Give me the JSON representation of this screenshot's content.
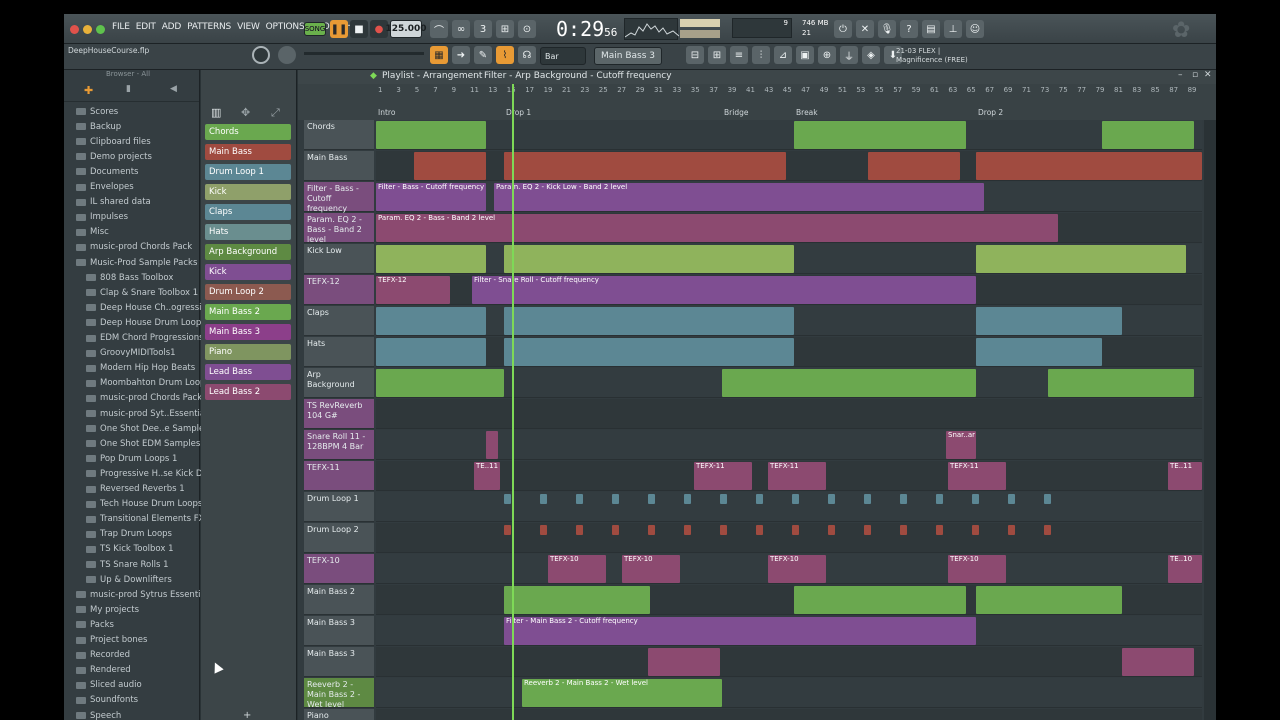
{
  "app": {
    "project_file": "DeepHouseCourse.flp",
    "menu": [
      "FILE",
      "EDIT",
      "ADD",
      "PATTERNS",
      "VIEW",
      "OPTIONS",
      "TOOLS",
      "HELP"
    ],
    "transport": {
      "mode": "SONG",
      "tempo": "125.000",
      "time": "0:29",
      "time_sub": "56",
      "cpu_mem": "746 MB",
      "cpu_voices": "21",
      "cpu_num": "9",
      "pattern": "Main Bass 3",
      "snap": "Bar",
      "hint_line1": "21-03 FLEX |",
      "hint_line2": "Magnificence (FREE)"
    }
  },
  "browser": {
    "title": "Browser - All",
    "items": [
      {
        "label": "Scores",
        "indent": false
      },
      {
        "label": "Backup",
        "indent": false
      },
      {
        "label": "Clipboard files",
        "indent": false
      },
      {
        "label": "Demo projects",
        "indent": false
      },
      {
        "label": "Documents",
        "indent": false
      },
      {
        "label": "Envelopes",
        "indent": false
      },
      {
        "label": "IL shared data",
        "indent": false
      },
      {
        "label": "Impulses",
        "indent": false
      },
      {
        "label": "Misc",
        "indent": false
      },
      {
        "label": "music-prod Chords Pack",
        "indent": false
      },
      {
        "label": "Music-Prod Sample Packs",
        "indent": false
      },
      {
        "label": "808 Bass Toolbox",
        "indent": true
      },
      {
        "label": "Clap & Snare Toolbox 1",
        "indent": true
      },
      {
        "label": "Deep House Ch..ogressions 1",
        "indent": true
      },
      {
        "label": "Deep House Drum Loops",
        "indent": true
      },
      {
        "label": "EDM Chord Progressions 1",
        "indent": true
      },
      {
        "label": "GroovyMIDITools1",
        "indent": true
      },
      {
        "label": "Modern Hip Hop Beats",
        "indent": true
      },
      {
        "label": "Moombahton Drum Loops",
        "indent": true
      },
      {
        "label": "music-prod Chords Pack",
        "indent": true
      },
      {
        "label": "music-prod Syt..Essentials 1",
        "indent": true
      },
      {
        "label": "One Shot Dee..e Samples #1",
        "indent": true
      },
      {
        "label": "One Shot EDM Samples #1",
        "indent": true
      },
      {
        "label": "Pop Drum Loops 1",
        "indent": true
      },
      {
        "label": "Progressive H..se Kick Drums",
        "indent": true
      },
      {
        "label": "Reversed Reverbs 1",
        "indent": true
      },
      {
        "label": "Tech House Drum Loops",
        "indent": true
      },
      {
        "label": "Transitional Elements FX",
        "indent": true
      },
      {
        "label": "Trap Drum Loops",
        "indent": true
      },
      {
        "label": "TS Kick Toolbox 1",
        "indent": true
      },
      {
        "label": "TS Snare Rolls 1",
        "indent": true
      },
      {
        "label": "Up & Downlifters",
        "indent": true
      },
      {
        "label": "music-prod Sytrus Essentials 1",
        "indent": false
      },
      {
        "label": "My projects",
        "indent": false
      },
      {
        "label": "Packs",
        "indent": false
      },
      {
        "label": "Project bones",
        "indent": false
      },
      {
        "label": "Recorded",
        "indent": false
      },
      {
        "label": "Rendered",
        "indent": false
      },
      {
        "label": "Sliced audio",
        "indent": false
      },
      {
        "label": "Soundfonts",
        "indent": false
      },
      {
        "label": "Speech",
        "indent": false
      }
    ]
  },
  "channels": [
    {
      "label": "Chords",
      "color": "#6aa84f"
    },
    {
      "label": "Main Bass",
      "color": "#a04b40"
    },
    {
      "label": "Drum Loop 1",
      "color": "#5c8794"
    },
    {
      "label": "Kick",
      "color": "#8fa06a"
    },
    {
      "label": "Claps",
      "color": "#5c8794"
    },
    {
      "label": "Hats",
      "color": "#6a8e8f"
    },
    {
      "label": "Arp Background",
      "color": "#5e8a43"
    },
    {
      "label": "Kick",
      "color": "#7f4e92"
    },
    {
      "label": "Drum Loop 2",
      "color": "#8c5a50"
    },
    {
      "label": "Main Bass 2",
      "color": "#6aa84f"
    },
    {
      "label": "Main Bass 3",
      "color": "#8c3f8a"
    },
    {
      "label": "Piano",
      "color": "#7f9560"
    },
    {
      "label": "Lead Bass",
      "color": "#7f4e92"
    },
    {
      "label": "Lead Bass 2",
      "color": "#8c4a70"
    }
  ],
  "playlist": {
    "title": "Playlist - Arrangement",
    "breadcrumb": "Filter - Arp Background - Cutoff frequency",
    "markers": [
      "Intro",
      "Drop 1",
      "Bridge",
      "Break",
      "Drop 2"
    ],
    "bars": [
      "1",
      "3",
      "5",
      "7",
      "9",
      "11",
      "13",
      "15",
      "17",
      "19",
      "21",
      "23",
      "25",
      "27",
      "29",
      "31",
      "33",
      "35",
      "37",
      "39",
      "41",
      "43",
      "45",
      "47",
      "49",
      "51",
      "53",
      "55",
      "57",
      "59",
      "61",
      "63",
      "65",
      "67",
      "69",
      "71",
      "73",
      "75",
      "77",
      "79",
      "81",
      "83",
      "85",
      "87",
      "89"
    ],
    "tracks": [
      "Chords",
      "Main Bass",
      "Filter - Bass - Cutoff frequency",
      "Param. EQ 2 - Bass - Band 2 level",
      "Kick Low",
      "TEFX-12",
      "Claps",
      "Hats",
      "Arp Background",
      "TS RevReverb 104 G#",
      "Snare Roll 11 - 128BPM 4 Bar",
      "TEFX-11",
      "Drum Loop 1",
      "Drum Loop 2",
      "TEFX-10",
      "Main Bass 2",
      "Main Bass 3",
      "Main Bass 3",
      "Reeverb 2 - Main Bass 2 - Wet level",
      "Piano"
    ],
    "clip_labels": {
      "filter_bass": "Filter - Bass - Cutoff frequency",
      "param_eq_kick": "Param. EQ 2 - Kick Low - Band 2 level",
      "param_eq_bass": "Param. EQ 2 - Bass - Band 2 level",
      "tefx12": "TEFX-12",
      "snare_roll_filter": "Filter - Snare Roll - Cutoff frequency",
      "tefx11": "TEFX-11",
      "tefx10": "TEFX-10",
      "te10_short": "TE..10",
      "te11_short": "TE..11",
      "filter_main_bass2": "Filter - Main Bass 2 - Cutoff frequency",
      "reeverb": "Reeverb 2 - Main Bass 2 - Wet level",
      "snare_short": "Snar..ar"
    }
  }
}
